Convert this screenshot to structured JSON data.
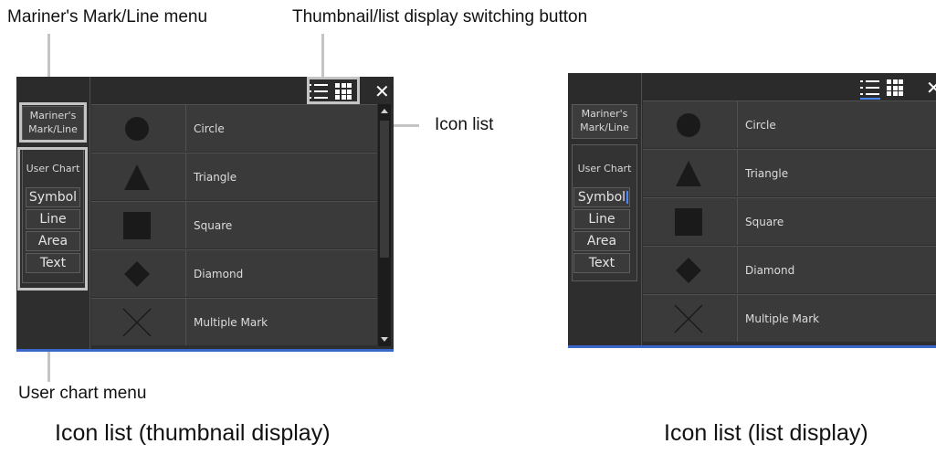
{
  "annotations": {
    "mariner_menu": "Mariner's Mark/Line menu",
    "switch_button": "Thumbnail/list display switching button",
    "icon_list": "Icon list",
    "user_chart_menu": "User chart menu"
  },
  "captions": {
    "left": "Icon list (thumbnail display)",
    "right": "Icon list (list display)"
  },
  "panel": {
    "mariner_button": "Mariner's\nMark/Line",
    "user_chart_title": "User Chart",
    "submenu": [
      "Symbol",
      "Line",
      "Area",
      "Text"
    ],
    "active_submenu_right": "Symbol",
    "close_glyph": "✕",
    "icons": [
      {
        "label": "Circle",
        "shape": "circle-icon"
      },
      {
        "label": "Triangle",
        "shape": "triangle-icon"
      },
      {
        "label": "Square",
        "shape": "square-icon"
      },
      {
        "label": "Diamond",
        "shape": "diamond-icon"
      },
      {
        "label": "Multiple Mark",
        "shape": "cross-icon"
      }
    ]
  },
  "colors": {
    "panel_bg": "#2e2e2e",
    "row_bg": "#3a3a3a",
    "accent": "#3a66c7",
    "highlight": "#c4c4c4"
  }
}
